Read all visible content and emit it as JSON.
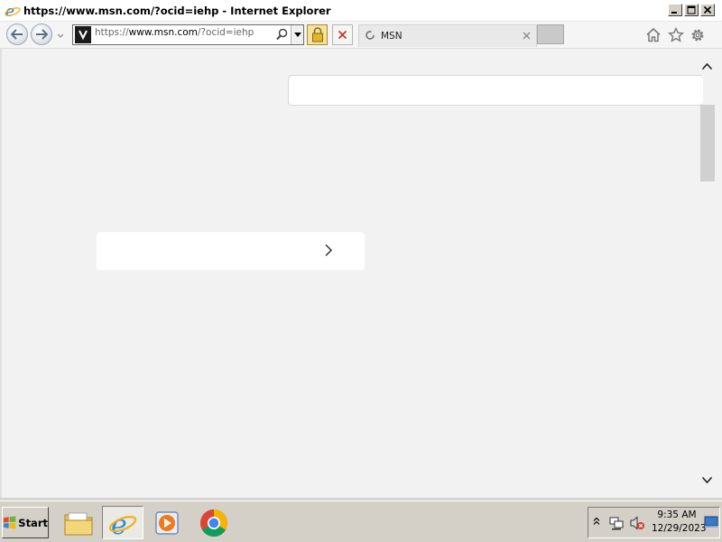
{
  "window": {
    "title": "https://www.msn.com/?ocid=iehp - Internet Explorer"
  },
  "navbar": {
    "address_scheme": "https://",
    "address_host": "www.msn.com",
    "address_path": "/?ocid=iehp"
  },
  "tab": {
    "title": "MSN"
  },
  "taskbar": {
    "start_label": "Start",
    "clock_time": "9:35 AM",
    "clock_date": "12/29/2023"
  },
  "icons": {
    "back": "back-arrow-icon",
    "forward": "forward-arrow-icon",
    "search": "search-icon",
    "lock": "lock-icon",
    "stop": "close-icon",
    "loading": "loading-spinner-icon",
    "home": "home-icon",
    "favorites": "star-icon",
    "tools": "gear-icon",
    "chevron_right": "chevron-right-icon"
  },
  "colors": {
    "ie_blue": "#1e6fc8",
    "content_bg": "#f2f2f2",
    "taskbar_bg": "#d4d0c8"
  }
}
